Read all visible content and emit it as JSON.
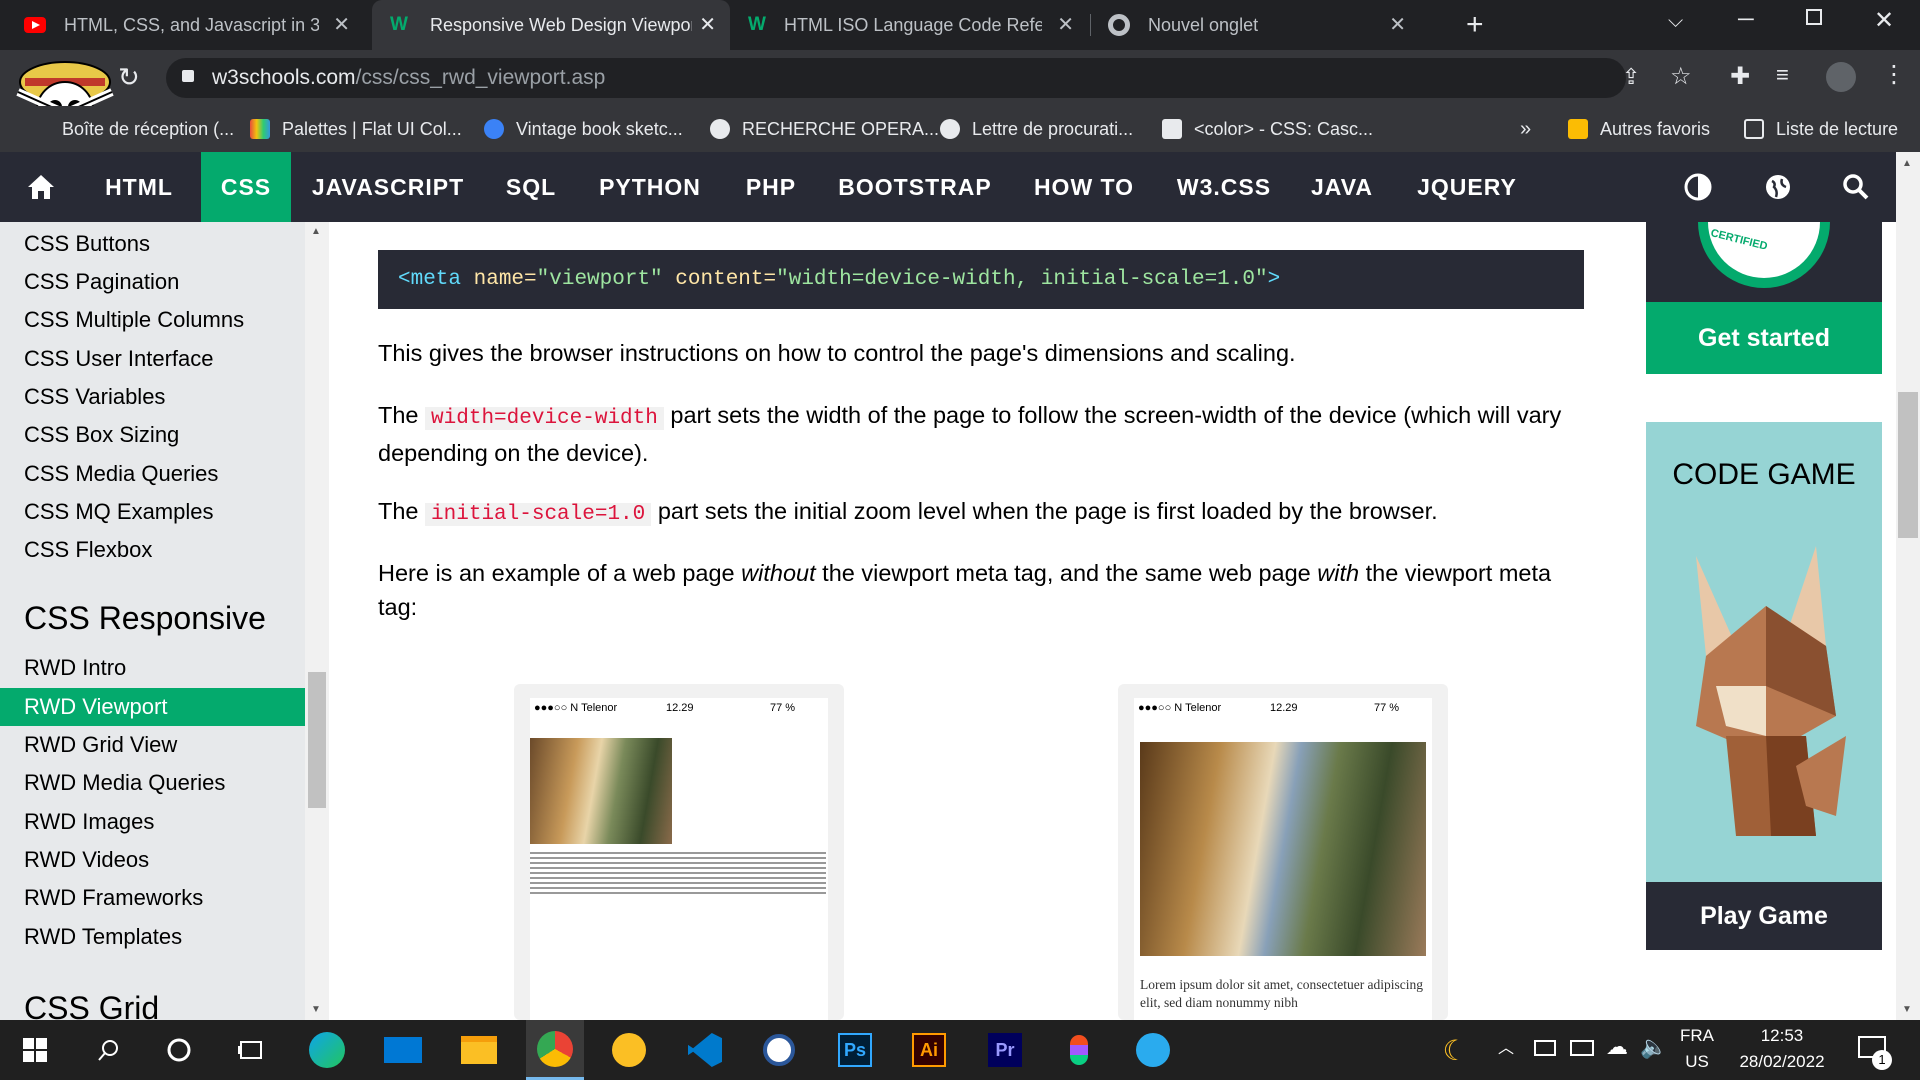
{
  "browser": {
    "tabs": [
      {
        "title": "HTML, CSS, and Javascript in 30 m",
        "icon": "youtube-icon"
      },
      {
        "title": "Responsive Web Design Viewpor",
        "icon": "w3schools-icon",
        "active": true
      },
      {
        "title": "HTML ISO Language Code Refere",
        "icon": "w3schools-icon"
      },
      {
        "title": "Nouvel onglet",
        "icon": "chrome-icon"
      }
    ],
    "url_domain": "w3schools.com",
    "url_path": "/css/css_rwd_viewport.asp",
    "bookmarks": [
      {
        "label": "Boîte de réception (...",
        "color": "#ea4335"
      },
      {
        "label": "Palettes | Flat UI Col...",
        "color": "#e67e22"
      },
      {
        "label": "Vintage book sketc...",
        "color": "#3b82f6"
      },
      {
        "label": "RECHERCHE OPERA...",
        "color": "#e8eaed"
      },
      {
        "label": "Lettre de procurati...",
        "color": "#e8eaed"
      },
      {
        "label": "<color> - CSS: Casc...",
        "color": "#e8eaed"
      }
    ],
    "bookmarks_more": "»",
    "other_bookmarks": "Autres favoris",
    "reading_list": "Liste de lecture"
  },
  "topnav": {
    "items": [
      "HTML",
      "CSS",
      "JAVASCRIPT",
      "SQL",
      "PYTHON",
      "PHP",
      "BOOTSTRAP",
      "HOW TO",
      "W3.CSS",
      "JAVA",
      "JQUERY"
    ],
    "active": "CSS"
  },
  "sidebar": {
    "items_top": [
      "CSS Buttons",
      "CSS Pagination",
      "CSS Multiple Columns",
      "CSS User Interface",
      "CSS Variables",
      "CSS Box Sizing",
      "CSS Media Queries",
      "CSS MQ Examples",
      "CSS Flexbox"
    ],
    "heading_responsive": "CSS Responsive",
    "items_rwd": [
      "RWD Intro",
      "RWD Viewport",
      "RWD Grid View",
      "RWD Media Queries",
      "RWD Images",
      "RWD Videos",
      "RWD Frameworks",
      "RWD Templates"
    ],
    "active": "RWD Viewport",
    "heading_grid": "CSS Grid"
  },
  "content": {
    "code_tag": "<meta",
    "code_attr1": "name=",
    "code_val1": "\"viewport\"",
    "code_attr2": "content=",
    "code_val2": "\"width=device-width, initial-scale=1.0\"",
    "code_end": ">",
    "p1": "This gives the browser instructions on how to control the page's dimensions and scaling.",
    "p2_pre": "The",
    "p2_code": "width=device-width",
    "p2_post": "part sets the width of the page to follow the screen-width of the device (which will vary depending on the device).",
    "p3_pre": "The",
    "p3_code": "initial-scale=1.0",
    "p3_post": "part sets the initial zoom level when the page is first loaded by the browser.",
    "p4_a": "Here is an example of a web page",
    "p4_em1": "without",
    "p4_b": "the viewport meta tag, and the same web page",
    "p4_em2": "with",
    "p4_c": "the viewport meta tag:",
    "phone_carrier": "●●●○○ N Telenor",
    "phone_time": "12.29",
    "phone_battery": "77 %",
    "phone2_text": "Lorem ipsum dolor sit amet, consectetuer adipiscing elit, sed diam nonummy nibh"
  },
  "right": {
    "certified": "CERTIFIED",
    "get_started": "Get started",
    "code_game": "CODE GAME",
    "play_game": "Play Game"
  },
  "taskbar": {
    "lang": "FRA",
    "region": "US",
    "time": "12:53",
    "date": "28/02/2022",
    "notifications": "1"
  }
}
